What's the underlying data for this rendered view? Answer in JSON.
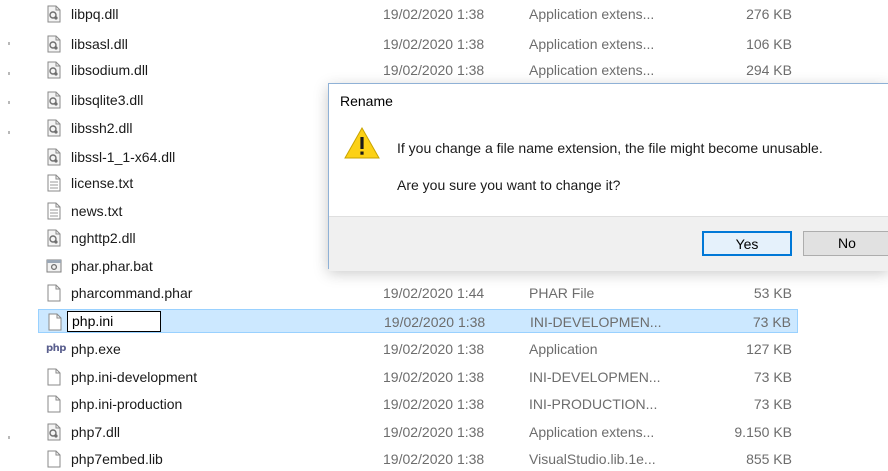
{
  "files": [
    {
      "name": "libpq.dll",
      "date": "19/02/2020 1:38",
      "type": "Application extens...",
      "size": "276 KB",
      "icon": "dll-icon"
    },
    {
      "name": "libsasl.dll",
      "date": "19/02/2020 1:38",
      "type": "Application extens...",
      "size": "106 KB",
      "icon": "dll-icon"
    },
    {
      "name": "libsodium.dll",
      "date": "19/02/2020 1:38",
      "type": "Application extens...",
      "size": "294 KB",
      "icon": "dll-icon"
    },
    {
      "name": "libsqlite3.dll",
      "date": "",
      "type": "",
      "size": "",
      "icon": "dll-icon"
    },
    {
      "name": "libssh2.dll",
      "date": "",
      "type": "",
      "size": "",
      "icon": "dll-icon"
    },
    {
      "name": "libssl-1_1-x64.dll",
      "date": "",
      "type": "",
      "size": "",
      "icon": "dll-icon"
    },
    {
      "name": "license.txt",
      "date": "",
      "type": "",
      "size": "",
      "icon": "text-file-icon"
    },
    {
      "name": "news.txt",
      "date": "",
      "type": "",
      "size": "",
      "icon": "text-file-icon"
    },
    {
      "name": "nghttp2.dll",
      "date": "",
      "type": "",
      "size": "",
      "icon": "dll-icon"
    },
    {
      "name": "phar.phar.bat",
      "date": "",
      "type": "",
      "size": "",
      "icon": "batch-file-icon"
    },
    {
      "name": "pharcommand.phar",
      "date": "19/02/2020 1:44",
      "type": "PHAR File",
      "size": "53 KB",
      "icon": "blank-file-icon"
    },
    {
      "name": "php.ini",
      "date": "19/02/2020 1:38",
      "type": "INI-DEVELOPMEN...",
      "size": "73 KB",
      "icon": "blank-file-icon",
      "selected": true
    },
    {
      "name": "php.exe",
      "date": "19/02/2020 1:38",
      "type": "Application",
      "size": "127 KB",
      "icon": "php-exe-icon"
    },
    {
      "name": "php.ini-development",
      "date": "19/02/2020 1:38",
      "type": "INI-DEVELOPMEN...",
      "size": "73 KB",
      "icon": "blank-file-icon"
    },
    {
      "name": "php.ini-production",
      "date": "19/02/2020 1:38",
      "type": "INI-PRODUCTION...",
      "size": "73 KB",
      "icon": "blank-file-icon"
    },
    {
      "name": "php7.dll",
      "date": "19/02/2020 1:38",
      "type": "Application extens...",
      "size": "9.150 KB",
      "icon": "dll-icon"
    },
    {
      "name": "php7embed.lib",
      "date": "19/02/2020 1:38",
      "type": "VisualStudio.lib.1e...",
      "size": "855 KB",
      "icon": "blank-file-icon"
    }
  ],
  "rename_value": "php.ini",
  "exe_badge": "php",
  "dialog": {
    "title": "Rename",
    "message": "If you change a file name extension, the file might become unusable.",
    "question": "Are you sure you want to change it?",
    "yes_label": "Yes",
    "no_label": "No",
    "icon": "warning-icon"
  },
  "colors": {
    "selection": "#cce8ff",
    "selection_border": "#99d1ff",
    "default_button_border": "#0078d7",
    "warning_yellow": "#fcd116"
  }
}
